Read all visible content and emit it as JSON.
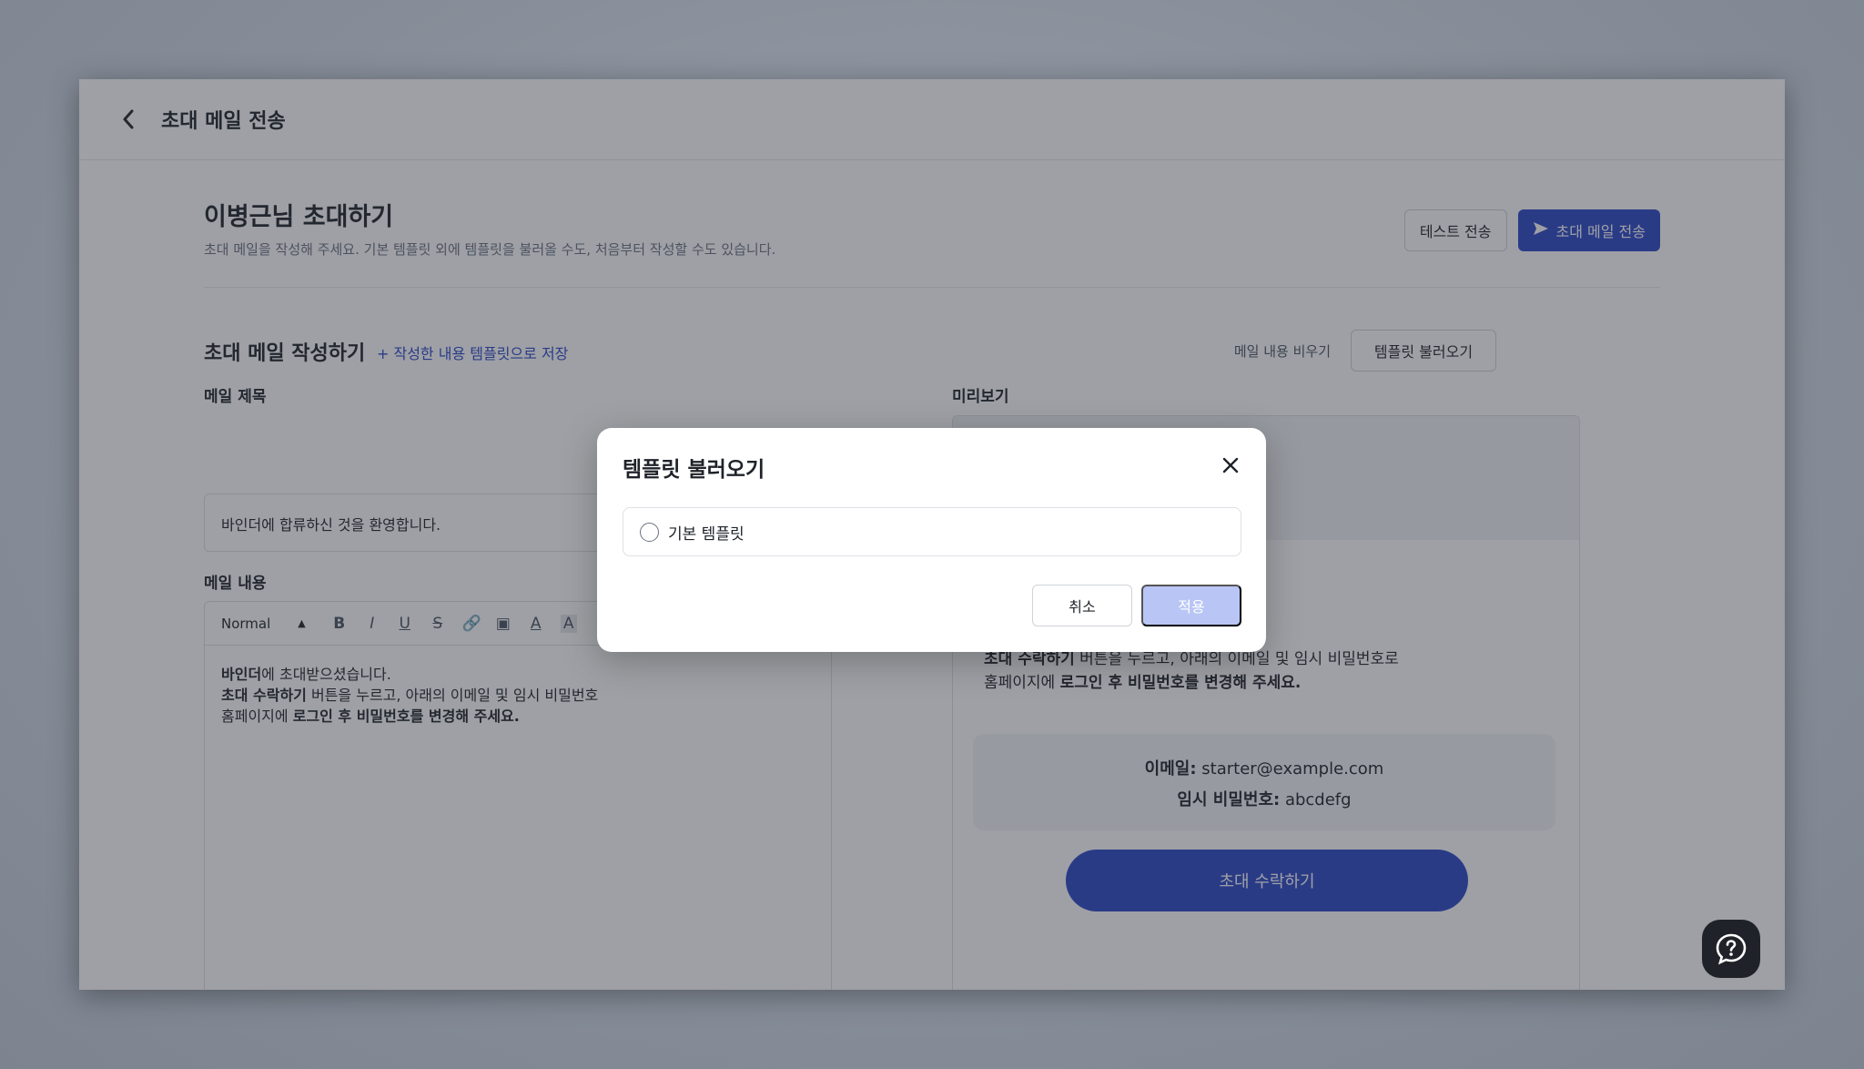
{
  "header": {
    "title": "초대 메일 전송"
  },
  "invite": {
    "title": "이병근님 초대하기",
    "description": "초대 메일을 작성해 주세요. 기본 템플릿 외에 템플릿을 불러올 수도, 처음부터 작성할 수도 있습니다.",
    "test_send_label": "테스트 전송",
    "send_label": "초대 메일 전송"
  },
  "compose": {
    "title": "초대 메일 작성하기",
    "save_template_label": "+ 작성한 내용 템플릿으로 저장",
    "clear_label": "메일 내용 비우기",
    "load_template_label": "템플릿 불러오기",
    "subject_label": "메일 제목",
    "subject_value": "바인더에 합류하신 것을 환영합니다.",
    "body_label": "메일 내용",
    "toolbar": {
      "format_select": "Normal"
    },
    "body": {
      "line1_bold": "바인더",
      "line1_rest": "에 초대받으셨습니다.",
      "line2_bold": "초대 수락하기",
      "line2_rest": " 버튼을 누르고, 아래의 이메일 및 임시 비밀번호",
      "line3_prefix": "홈페이지에 ",
      "line3_bold": "로그인 후 비밀번호를 변경해 주세요."
    }
  },
  "preview": {
    "label": "미리보기",
    "line2_bold": "초대 수락하기",
    "line2_rest": " 버튼을 누르고, 아래의 이메일 및 임시 비밀번호로",
    "line3_prefix": "홈페이지에 ",
    "line3_bold": "로그인 후 비밀번호를 변경해 주세요.",
    "email_label": "이메일:",
    "email_value": " starter@example.com",
    "password_label": "임시 비밀번호:",
    "password_value": " abcdefg",
    "accept_label": "초대 수락하기"
  },
  "modal": {
    "title": "템플릿 불러오기",
    "option_label": "기본 템플릿",
    "cancel_label": "취소",
    "apply_label": "적용"
  },
  "colors": {
    "primary": "#2c47c7",
    "apply_disabled": "#b9c6f5"
  }
}
